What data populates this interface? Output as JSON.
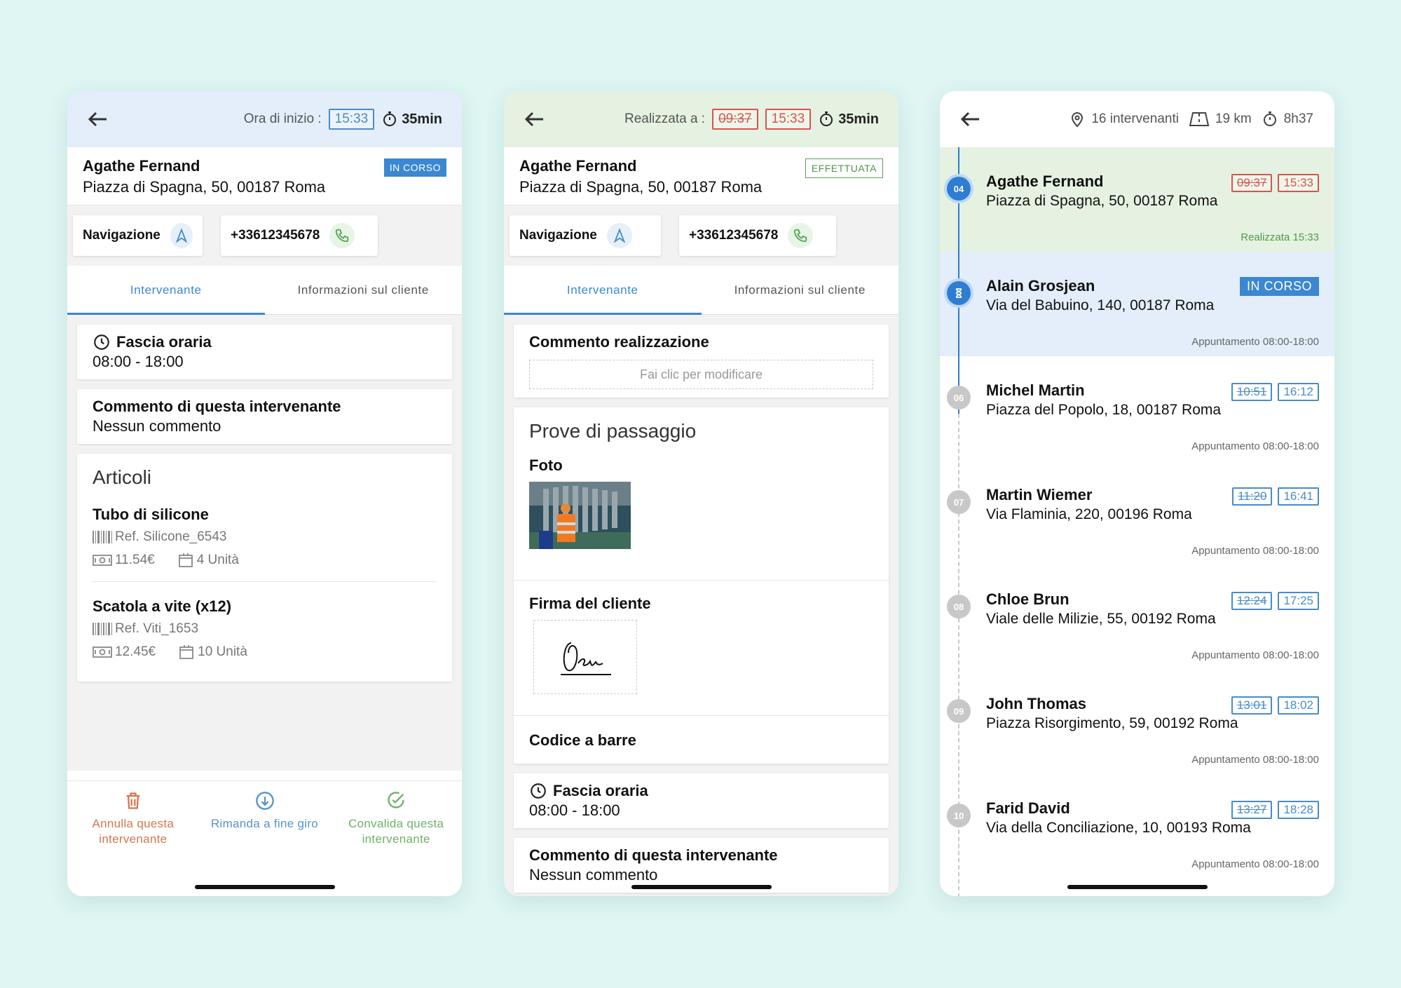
{
  "colors": {
    "accent": "#3b87d1",
    "danger": "#d9534f",
    "success": "#4c9a46",
    "background": "#dff6f3"
  },
  "screen1": {
    "start_label": "Ora di inizio :",
    "start_time": "15:33",
    "duration": "35min",
    "client_name": "Agathe Fernand",
    "client_address": "Piazza di Spagna, 50, 00187 Roma",
    "status": "IN CORSO",
    "nav_label": "Navigazione",
    "phone": "+33612345678",
    "tabs": [
      "Intervenante",
      "Informazioni sul cliente"
    ],
    "slot_title": "Fascia oraria",
    "slot_value": "08:00 - 18:00",
    "comment_title": "Commento di questa intervenante",
    "comment_value": "Nessun commento",
    "articles_title": "Articoli",
    "articles": [
      {
        "name": "Tubo di silicone",
        "ref": "Ref. Silicone_6543",
        "price": "11.54€",
        "qty": "4 Unità"
      },
      {
        "name": "Scatola a vite (x12)",
        "ref": "Ref. Viti_1653",
        "price": "12.45€",
        "qty": "10 Unità"
      }
    ],
    "footer": {
      "cancel": "Annulla questa intervenante",
      "postpone": "Rimanda a fine giro",
      "validate": "Convalida questa intervenante"
    }
  },
  "screen2": {
    "done_label": "Realizzata a :",
    "planned_time": "09:37",
    "actual_time": "15:33",
    "duration": "35min",
    "client_name": "Agathe Fernand",
    "client_address": "Piazza di Spagna, 50, 00187 Roma",
    "status": "EFFETTUATA",
    "nav_label": "Navigazione",
    "phone": "+33612345678",
    "tabs": [
      "Intervenante",
      "Informazioni sul cliente"
    ],
    "realization_comment_title": "Commento realizzazione",
    "realization_comment_placeholder": "Fai clic per modificare",
    "proofs_title": "Prove di passaggio",
    "photo_label": "Foto",
    "signature_label": "Firma del cliente",
    "barcode_label": "Codice a barre",
    "slot_title": "Fascia oraria",
    "slot_value": "08:00 - 18:00",
    "comment_title": "Commento di questa intervenante",
    "comment_value": "Nessun commento"
  },
  "screen3": {
    "count": "16 intervenanti",
    "distance": "19 km",
    "total_time": "8h37",
    "items": [
      {
        "index": "04",
        "name": "Agathe Fernand",
        "address": "Piazza di Spagna, 50, 00187 Roma",
        "planned": "09:37",
        "actual": "15:33",
        "footer": "Realizzata 15:33"
      },
      {
        "index": "",
        "name": "Alain Grosjean",
        "address": "Via del Babuino, 140, 00187 Roma",
        "status": "IN CORSO",
        "footer": "Appuntamento 08:00-18:00"
      },
      {
        "index": "06",
        "name": "Michel Martin",
        "address": "Piazza del Popolo, 18, 00187 Roma",
        "planned": "10:51",
        "actual": "16:12",
        "footer": "Appuntamento 08:00-18:00"
      },
      {
        "index": "07",
        "name": "Martin Wiemer",
        "address": "Via Flaminia, 220, 00196 Roma",
        "planned": "11:20",
        "actual": "16:41",
        "footer": "Appuntamento 08:00-18:00"
      },
      {
        "index": "08",
        "name": "Chloe Brun",
        "address": "Viale delle Milizie, 55, 00192 Roma",
        "planned": "12:24",
        "actual": "17:25",
        "footer": "Appuntamento 08:00-18:00"
      },
      {
        "index": "09",
        "name": "John Thomas",
        "address": "Piazza Risorgimento, 59, 00192 Roma",
        "planned": "13:01",
        "actual": "18:02",
        "footer": "Appuntamento 08:00-18:00"
      },
      {
        "index": "10",
        "name": "Farid David",
        "address": "Via della Conciliazione, 10, 00193 Roma",
        "planned": "13:27",
        "actual": "18:28",
        "footer": "Appuntamento 08:00-18:00"
      }
    ]
  }
}
